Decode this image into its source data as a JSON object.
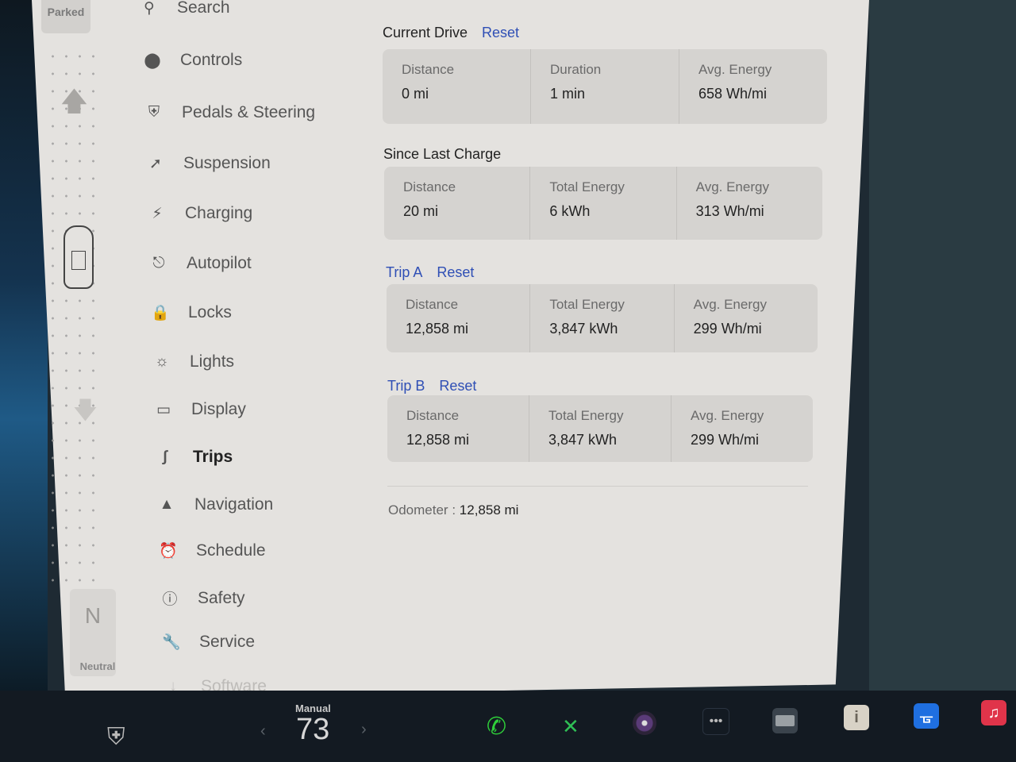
{
  "drive_rail": {
    "gear_top": "Parked",
    "gear_bottom_letter": "N",
    "gear_bottom_label": "Neutral"
  },
  "menu": {
    "items": [
      {
        "label": "Search",
        "icon": "search-icon"
      },
      {
        "label": "Controls",
        "icon": "toggle-icon"
      },
      {
        "label": "Pedals & Steering",
        "icon": "car-icon"
      },
      {
        "label": "Suspension",
        "icon": "suspension-icon"
      },
      {
        "label": "Charging",
        "icon": "lightning-icon"
      },
      {
        "label": "Autopilot",
        "icon": "steering-wheel-icon"
      },
      {
        "label": "Locks",
        "icon": "lock-icon"
      },
      {
        "label": "Lights",
        "icon": "sun-icon"
      },
      {
        "label": "Display",
        "icon": "display-icon"
      },
      {
        "label": "Trips",
        "icon": "trips-icon",
        "active": true
      },
      {
        "label": "Navigation",
        "icon": "navigation-arrow-icon"
      },
      {
        "label": "Schedule",
        "icon": "alarm-clock-icon"
      },
      {
        "label": "Safety",
        "icon": "safety-icon"
      },
      {
        "label": "Service",
        "icon": "wrench-icon"
      },
      {
        "label": "Software",
        "icon": "download-icon"
      }
    ]
  },
  "trips": {
    "current_drive": {
      "title": "Current Drive",
      "reset": "Reset",
      "stats": [
        {
          "label": "Distance",
          "value": "0 mi"
        },
        {
          "label": "Duration",
          "value": "1 min"
        },
        {
          "label": "Avg. Energy",
          "value": "658 Wh/mi"
        }
      ]
    },
    "since_last_charge": {
      "title": "Since Last Charge",
      "stats": [
        {
          "label": "Distance",
          "value": "20 mi"
        },
        {
          "label": "Total Energy",
          "value": "6 kWh"
        },
        {
          "label": "Avg. Energy",
          "value": "313 Wh/mi"
        }
      ]
    },
    "trip_a": {
      "title": "Trip A",
      "reset": "Reset",
      "stats": [
        {
          "label": "Distance",
          "value": "12,858 mi"
        },
        {
          "label": "Total Energy",
          "value": "3,847 kWh"
        },
        {
          "label": "Avg. Energy",
          "value": "299 Wh/mi"
        }
      ]
    },
    "trip_b": {
      "title": "Trip B",
      "reset": "Reset",
      "stats": [
        {
          "label": "Distance",
          "value": "12,858 mi"
        },
        {
          "label": "Total Energy",
          "value": "3,847 kWh"
        },
        {
          "label": "Avg. Energy",
          "value": "299 Wh/mi"
        }
      ]
    },
    "odometer_label": "Odometer",
    "odometer_sep": ":",
    "odometer_value": "12,858 mi"
  },
  "dock": {
    "climate_mode": "Manual",
    "temperature": "73",
    "icons": [
      "car-icon",
      "phone-icon",
      "toybox-icon",
      "camera-icon",
      "more-icon",
      "dashcam-icon",
      "manual-icon",
      "bluetooth-icon",
      "music-icon"
    ]
  },
  "colors": {
    "accent_link": "#2f4fb5",
    "phone": "#2fcf3a",
    "toybox": "#2fbf55",
    "bluetooth": "#1f6fe0",
    "music": "#e0344a"
  }
}
